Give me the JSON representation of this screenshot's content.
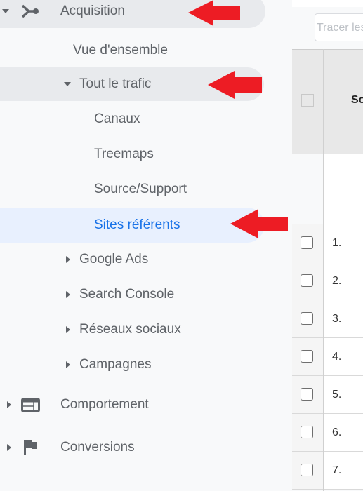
{
  "sidebar": {
    "acquisition": {
      "label": "Acquisition",
      "icon": "acquisition-branch-icon"
    },
    "vue_ensemble": {
      "label": "Vue d'ensemble"
    },
    "tout_trafic": {
      "label": "Tout le trafic"
    },
    "canaux": {
      "label": "Canaux"
    },
    "treemaps": {
      "label": "Treemaps"
    },
    "source_support": {
      "label": "Source/Support"
    },
    "sites_referents": {
      "label": "Sites référents",
      "selected": true
    },
    "google_ads": {
      "label": "Google Ads"
    },
    "search_console": {
      "label": "Search Console"
    },
    "reseaux_sociaux": {
      "label": "Réseaux sociaux"
    },
    "campagnes": {
      "label": "Campagnes"
    },
    "comportement": {
      "label": "Comportement",
      "icon": "behavior-icon"
    },
    "conversions": {
      "label": "Conversions",
      "icon": "flag-icon"
    }
  },
  "colors": {
    "accent": "#1a73e8",
    "annotation_arrow": "#ed1c24",
    "selected_bg": "#e8f0fe",
    "highlight_bg": "#e8eaed"
  },
  "main": {
    "trace_button": "Tracer les",
    "table": {
      "header_col": "So",
      "rows": [
        "1.",
        "2.",
        "3.",
        "4.",
        "5.",
        "6.",
        "7."
      ]
    }
  }
}
